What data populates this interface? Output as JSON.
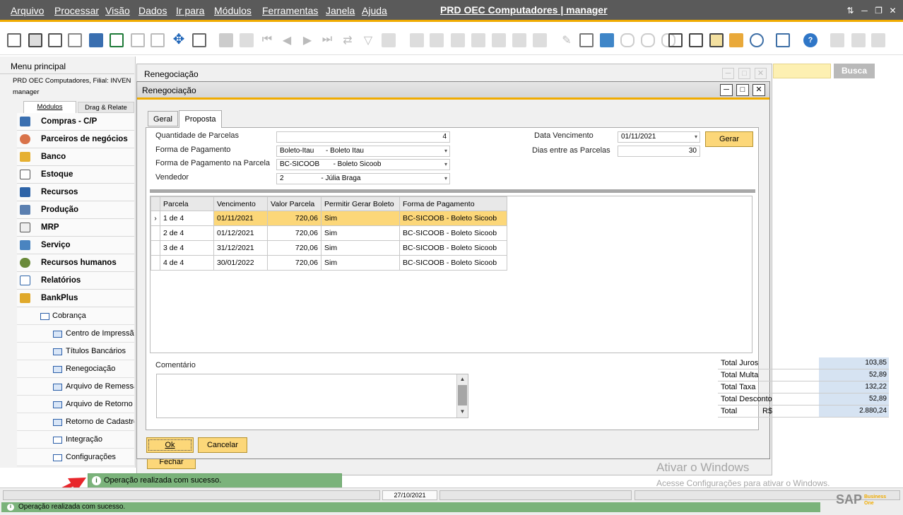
{
  "app": {
    "title": "PRD OEC Computadores | manager",
    "menu": [
      "Arquivo",
      "Processar",
      "Visão",
      "Dados",
      "Ir para",
      "Módulos",
      "Ferramentas",
      "Janela",
      "Ajuda"
    ],
    "accent": "#f0ab00"
  },
  "search": {
    "button": "Busca"
  },
  "main_menu": {
    "title": "Menu principal",
    "company": "PRD OEC Computadores, Filial: INVEN",
    "user": "manager",
    "tabs": [
      "Módulos",
      "Drag & Relate"
    ],
    "modules": [
      "Compras - C/P",
      "Parceiros de negócios",
      "Banco",
      "Estoque",
      "Recursos",
      "Produção",
      "MRP",
      "Serviço",
      "Recursos humanos",
      "Relatórios",
      "BankPlus"
    ],
    "folder": "Cobrança",
    "sub_items": [
      "Centro de Impressão",
      "Títulos Bancários",
      "Renegociação",
      "Arquivo de Remessa",
      "Arquivo de Retorno",
      "Retorno de Cadastro",
      "Integração",
      "Configurações"
    ]
  },
  "back_window": {
    "title": "Renegociação",
    "fechar": "Fechar"
  },
  "dialog": {
    "title": "Renegociação",
    "tabs": [
      "Geral",
      "Proposta"
    ],
    "fields": {
      "qtd_parcelas_label": "Quantidade de Parcelas",
      "qtd_parcelas": "4",
      "forma_pgto_label": "Forma de Pagamento",
      "forma_pgto": "Boleto-Itau      - Boleto Itau",
      "forma_pgto_parcela_label": "Forma de Pagamento na Parcela",
      "forma_pgto_parcela": "BC-SICOOB       - Boleto Sicoob",
      "vendedor_label": "Vendedor",
      "vendedor": "2                   - Júlia Braga",
      "data_venc_label": "Data Vencimento",
      "data_venc": "01/11/2021",
      "dias_label": "Dias entre as Parcelas",
      "dias": "30"
    },
    "gerar": "Gerar",
    "grid": {
      "columns": [
        "Parcela",
        "Vencimento",
        "Valor Parcela",
        "Permitir Gerar Boleto",
        "Forma de Pagamento"
      ],
      "rows": [
        [
          "1 de 4",
          "01/11/2021",
          "720,06",
          "Sim",
          "BC-SICOOB - Boleto Sicoob"
        ],
        [
          "2 de 4",
          "01/12/2021",
          "720,06",
          "Sim",
          "BC-SICOOB - Boleto Sicoob"
        ],
        [
          "3 de 4",
          "31/12/2021",
          "720,06",
          "Sim",
          "BC-SICOOB - Boleto Sicoob"
        ],
        [
          "4 de 4",
          "30/01/2022",
          "720,06",
          "Sim",
          "BC-SICOOB - Boleto Sicoob"
        ]
      ]
    },
    "comentario_label": "Comentário",
    "totals": [
      {
        "label": "Total  Juros",
        "value": "103,85"
      },
      {
        "label": "Total Multa",
        "value": "52,89"
      },
      {
        "label": "Total Taxa",
        "value": "132,22"
      },
      {
        "label": "Total Desconto",
        "value": "52,89"
      },
      {
        "label": "Total",
        "currency": "R$",
        "value": "2.880,24"
      }
    ],
    "ok": "Ok",
    "cancelar": "Cancelar"
  },
  "watermark": {
    "line1": "Ativar o Windows",
    "line2": "Acesse Configurações para ativar o Windows."
  },
  "toast": "Operação realizada com sucesso.",
  "statusbar": {
    "date": "27/10/2021",
    "message": "Operação realizada com sucesso.",
    "brand": "SAP",
    "brand_sub": "Business One"
  }
}
